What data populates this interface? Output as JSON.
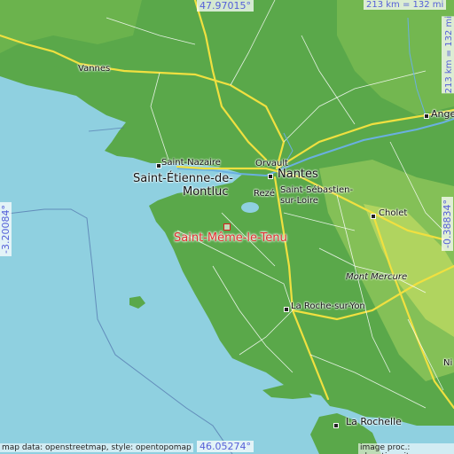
{
  "place": {
    "name": "Saint-Même-le-Tenu",
    "marker_color": "#d82020"
  },
  "coordinates": {
    "north": "47.97015°",
    "south": "46.05274°",
    "west": "-3.20084°",
    "east": "-0.38834°"
  },
  "scale": {
    "horizontal": "213 km = 132 mi",
    "vertical": "213 km = 132 mi"
  },
  "attribution": {
    "left": "map data: openstreetmap, style: opentopomap",
    "right": "image proc.: elevation.city"
  },
  "cities": {
    "vannes": "Vannes",
    "saint_nazaire": "Saint-Nazaire",
    "saint_etienne": "Saint-Étienne-de-",
    "montluc": "Montluc",
    "orvault": "Orvault",
    "nantes": "Nantes",
    "reze": "Rezé",
    "saint_sebastien": "Saint-Sébastien-",
    "sur_loire": "sur-Loire",
    "angers": "Ange",
    "cholet": "Cholet",
    "mont_mercure": "Mont Mercure",
    "la_roche": "La Roche-sur-Yon",
    "la_rochelle": "La Rochelle",
    "niort": "Ni"
  },
  "colors": {
    "sea": "#8fd0e0",
    "land": "#58a84a",
    "highland": "#b9d65a",
    "road_major": "#f0e040",
    "coord_text": "#5560d8"
  }
}
